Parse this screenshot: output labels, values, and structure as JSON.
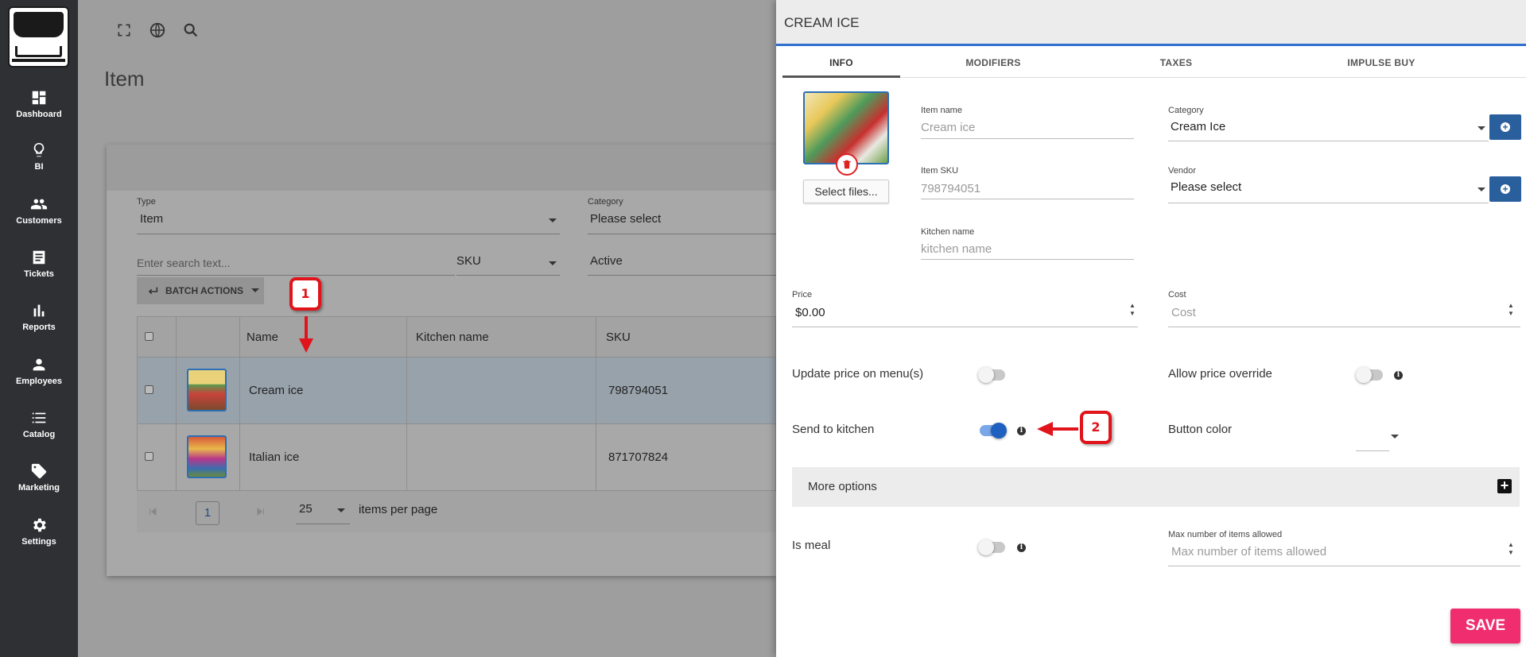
{
  "sidebar": {
    "items": [
      {
        "label": "Dashboard",
        "icon": "dashboard-icon"
      },
      {
        "label": "BI",
        "icon": "lightbulb-icon"
      },
      {
        "label": "Customers",
        "icon": "people-icon"
      },
      {
        "label": "Tickets",
        "icon": "ticket-icon"
      },
      {
        "label": "Reports",
        "icon": "bar-chart-icon"
      },
      {
        "label": "Employees",
        "icon": "person-icon"
      },
      {
        "label": "Catalog",
        "icon": "list-icon"
      },
      {
        "label": "Marketing",
        "icon": "tag-icon"
      },
      {
        "label": "Settings",
        "icon": "gear-icon"
      }
    ]
  },
  "main": {
    "title": "Item",
    "filters": {
      "type_label": "Type",
      "type_value": "Item",
      "category_label": "Category",
      "category_value": "Please select",
      "search_placeholder": "Enter search text...",
      "sku_value": "SKU",
      "status_value": "Active"
    },
    "batch_actions": "BATCH ACTIONS",
    "table": {
      "columns": [
        "Name",
        "Kitchen name",
        "SKU"
      ],
      "rows": [
        {
          "name": "Cream ice",
          "kitchen": "",
          "sku": "798794051"
        },
        {
          "name": "Italian ice",
          "kitchen": "",
          "sku": "871707824"
        }
      ]
    },
    "pager": {
      "page": "1",
      "per_page": "25",
      "per_page_label": "items per page"
    }
  },
  "panel": {
    "title": "CREAM ICE",
    "tabs": [
      "INFO",
      "MODIFIERS",
      "TAXES",
      "IMPULSE BUY"
    ],
    "select_files": "Select files...",
    "item_name_label": "Item name",
    "item_name_value": "Cream ice",
    "category_label": "Category",
    "category_value": "Cream Ice",
    "item_sku_label": "Item SKU",
    "item_sku_value": "798794051",
    "vendor_label": "Vendor",
    "vendor_value": "Please select",
    "kitchen_name_label": "Kitchen name",
    "kitchen_name_placeholder": "kitchen name",
    "price_label": "Price",
    "price_value": "$0.00",
    "cost_label": "Cost",
    "cost_placeholder": "Cost",
    "update_price_label": "Update price on menu(s)",
    "allow_override_label": "Allow price override",
    "send_kitchen_label": "Send to kitchen",
    "button_color_label": "Button color",
    "more_options_label": "More options",
    "is_meal_label": "Is meal",
    "max_items_label": "Max number of items allowed",
    "max_items_placeholder": "Max number of items allowed",
    "save_label": "SAVE",
    "toggles": {
      "update_price": false,
      "allow_override": false,
      "send_kitchen": true,
      "is_meal": false
    }
  },
  "callouts": [
    "1",
    "2"
  ],
  "colors": {
    "accent": "#2f6fd0",
    "save": "#ef2d6f",
    "callout": "#e0141a"
  }
}
